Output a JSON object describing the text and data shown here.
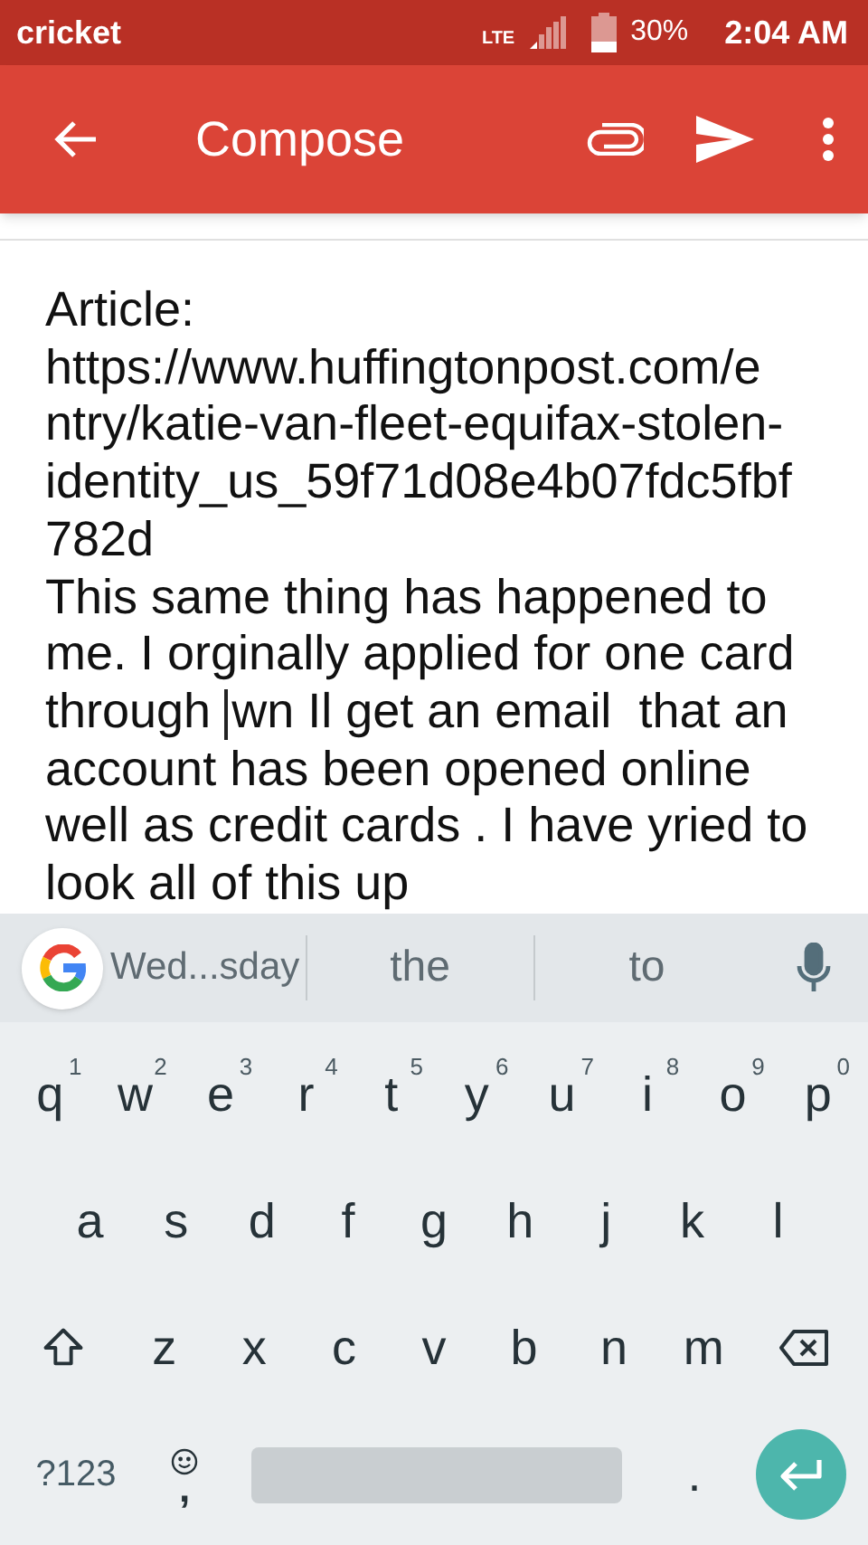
{
  "status_bar": {
    "carrier": "cricket",
    "network": "LTE",
    "battery": "30%",
    "time": "2:04 AM"
  },
  "app_bar": {
    "title": "Compose"
  },
  "body": {
    "lines": [
      {
        "text": "Article:"
      },
      {
        "text": "https://www.huffingtonpost.com/e"
      },
      {
        "text": "ntry/katie-van-fleet-equifax-stolen-"
      },
      {
        "text": "identity_us_59f71d08e4b07fdc5fbf"
      },
      {
        "text": "782d"
      },
      {
        "text": "This same thing has happened to"
      },
      {
        "text": "me. I orginally applied for one card"
      },
      {
        "text": "through ",
        "text_after_caret": "wn Il get an email  that an"
      },
      {
        "text": "account has been opened online"
      },
      {
        "text": "well as credit cards . I have yried to"
      },
      {
        "text": "look all of this up"
      }
    ]
  },
  "keyboard": {
    "suggestions": [
      "Wed...sday",
      "the",
      "to"
    ],
    "key_rows": [
      {
        "keys": [
          {
            "kind": "letter",
            "label": "q",
            "hint": "1"
          },
          {
            "kind": "letter",
            "label": "w",
            "hint": "2"
          },
          {
            "kind": "letter",
            "label": "e",
            "hint": "3"
          },
          {
            "kind": "letter",
            "label": "r",
            "hint": "4"
          },
          {
            "kind": "letter",
            "label": "t",
            "hint": "5"
          },
          {
            "kind": "letter",
            "label": "y",
            "hint": "6"
          },
          {
            "kind": "letter",
            "label": "u",
            "hint": "7"
          },
          {
            "kind": "letter",
            "label": "i",
            "hint": "8"
          },
          {
            "kind": "letter",
            "label": "o",
            "hint": "9"
          },
          {
            "kind": "letter",
            "label": "p",
            "hint": "0"
          }
        ]
      },
      {
        "keys": [
          {
            "kind": "letter",
            "label": "a"
          },
          {
            "kind": "letter",
            "label": "s"
          },
          {
            "kind": "letter",
            "label": "d"
          },
          {
            "kind": "letter",
            "label": "f"
          },
          {
            "kind": "letter",
            "label": "g"
          },
          {
            "kind": "letter",
            "label": "h"
          },
          {
            "kind": "letter",
            "label": "j"
          },
          {
            "kind": "letter",
            "label": "k"
          },
          {
            "kind": "letter",
            "label": "l"
          }
        ]
      },
      {
        "keys": [
          {
            "kind": "shift"
          },
          {
            "kind": "letter",
            "label": "z"
          },
          {
            "kind": "letter",
            "label": "x"
          },
          {
            "kind": "letter",
            "label": "c"
          },
          {
            "kind": "letter",
            "label": "v"
          },
          {
            "kind": "letter",
            "label": "b"
          },
          {
            "kind": "letter",
            "label": "n"
          },
          {
            "kind": "letter",
            "label": "m"
          },
          {
            "kind": "backspace"
          }
        ]
      },
      {
        "keys": [
          {
            "kind": "symbols",
            "label": "?123"
          },
          {
            "kind": "emoji",
            "label": ","
          },
          {
            "kind": "space"
          },
          {
            "kind": "period",
            "label": "."
          },
          {
            "kind": "enter"
          }
        ]
      }
    ]
  }
}
